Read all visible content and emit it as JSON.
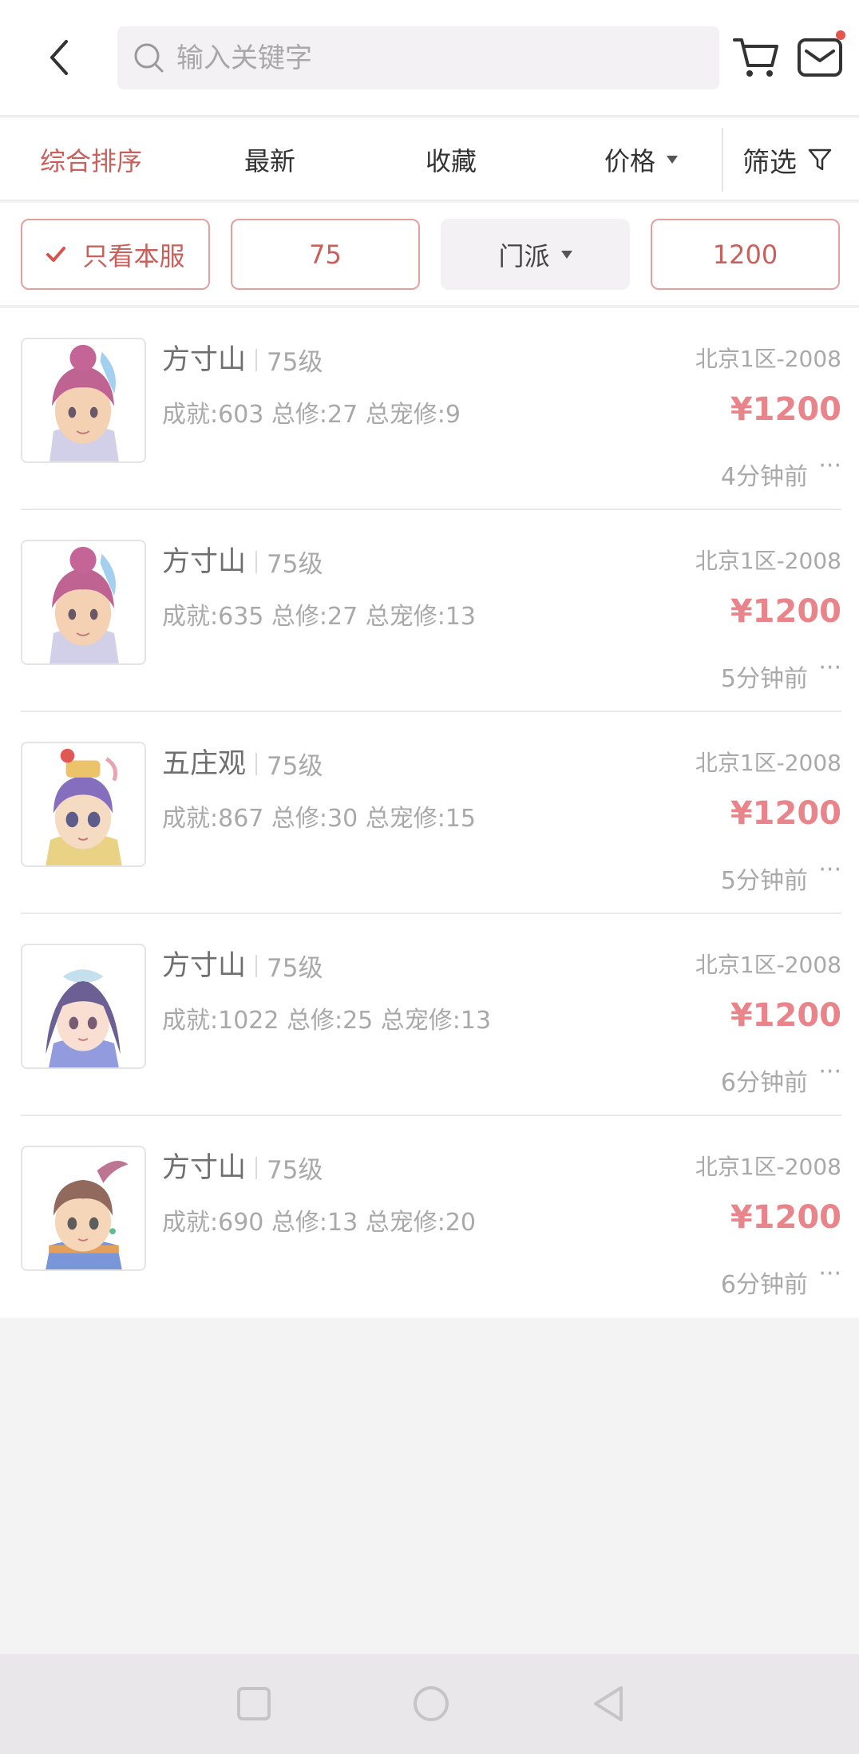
{
  "header": {
    "search_placeholder": "输入关键字"
  },
  "sort_tabs": [
    {
      "label": "综合排序",
      "active": true
    },
    {
      "label": "最新",
      "active": false
    },
    {
      "label": "收藏",
      "active": false
    },
    {
      "label": "价格",
      "active": false,
      "has_dropdown": true
    }
  ],
  "filter_label": "筛选",
  "chips": [
    {
      "label": "只看本服",
      "checked": true
    },
    {
      "label": "75"
    },
    {
      "label": "门派",
      "has_dropdown": true
    },
    {
      "label": "1200"
    }
  ],
  "items": [
    {
      "sect": "方寸山",
      "level": "75级",
      "stats": "成就:603 总修:27 总宠修:9",
      "server": "北京1区-2008",
      "price": "¥1200",
      "time": "4分钟前",
      "more": "···",
      "avatar": "avatar-fangcun-girl"
    },
    {
      "sect": "方寸山",
      "level": "75级",
      "stats": "成就:635 总修:27 总宠修:13",
      "server": "北京1区-2008",
      "price": "¥1200",
      "time": "5分钟前",
      "more": "···",
      "avatar": "avatar-fangcun-girl"
    },
    {
      "sect": "五庄观",
      "level": "75级",
      "stats": "成就:867 总修:30 总宠修:15",
      "server": "北京1区-2008",
      "price": "¥1200",
      "time": "5分钟前",
      "more": "···",
      "avatar": "avatar-wuzhuang-boy"
    },
    {
      "sect": "方寸山",
      "level": "75级",
      "stats": "成就:1022 总修:25 总宠修:13",
      "server": "北京1区-2008",
      "price": "¥1200",
      "time": "6分钟前",
      "more": "···",
      "avatar": "avatar-fangcun-maiden"
    },
    {
      "sect": "方寸山",
      "level": "75级",
      "stats": "成就:690 总修:13 总宠修:20",
      "server": "北京1区-2008",
      "price": "¥1200",
      "time": "6分钟前",
      "more": "···",
      "avatar": "avatar-fangcun-youth"
    }
  ],
  "colors": {
    "accent": "#c8605b",
    "price": "#e9848a"
  }
}
